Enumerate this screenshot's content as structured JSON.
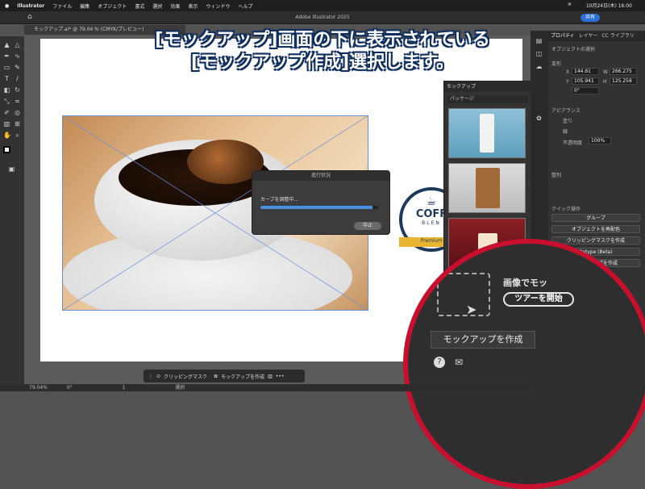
{
  "menubar": {
    "app": "Illustrator",
    "items": [
      "ファイル",
      "編集",
      "オブジェクト",
      "書式",
      "選択",
      "効果",
      "表示",
      "ウィンドウ",
      "ヘルプ"
    ],
    "clock": "10月24日(木)  16:00"
  },
  "window": {
    "title": "Adobe Illustrator 2025",
    "share": "共有",
    "doc_tab": "モックアップ.ai* @ 79.04 % (CMYK/プレビュー)"
  },
  "headline": {
    "line1": "[モックアップ]画面の下に表示されている",
    "line2": "[モックアップ作成]選択します。"
  },
  "progress": {
    "title": "進行状況",
    "message": "カーブを調整中...",
    "percent": 0.95,
    "stop": "中止"
  },
  "logo": {
    "text1": "COFF",
    "text2": "BLEN",
    "ribbon": "Premium"
  },
  "mockup_panel": {
    "title": "モックアップ",
    "category": "パッケージ"
  },
  "zoom": {
    "text_image": "画像でモッ",
    "tour": "ツアーを開始",
    "create": "モックアップを作成"
  },
  "right_panel": {
    "tabs": [
      "プロパティ",
      "レイヤー",
      "CC ライブラリ"
    ],
    "selection": "オブジェクトの選択",
    "transform": "変形",
    "x": "144.61",
    "w": "266.275",
    "y": "105.941",
    "h": "125.258",
    "angle": "0°",
    "appearance": "アピアランス",
    "fill": "塗り",
    "stroke": "線",
    "opacity_label": "不透明度",
    "opacity": "100%",
    "align": "整列",
    "quick_actions": "クイック操作",
    "btn_group": "グループ",
    "btn_recolor": "オブジェクトを再配色",
    "btn_clip": "クリッピングマスクを作成",
    "btn_retype": "Retype (Beta)",
    "btn_mockup": "モックアップを作成"
  },
  "context_bar": {
    "clip": "クリッピングマスク",
    "mockup": "モックアップを作成"
  },
  "status": {
    "zoom": "79.04%",
    "angle": "0°",
    "page": "1",
    "mode": "選択"
  }
}
